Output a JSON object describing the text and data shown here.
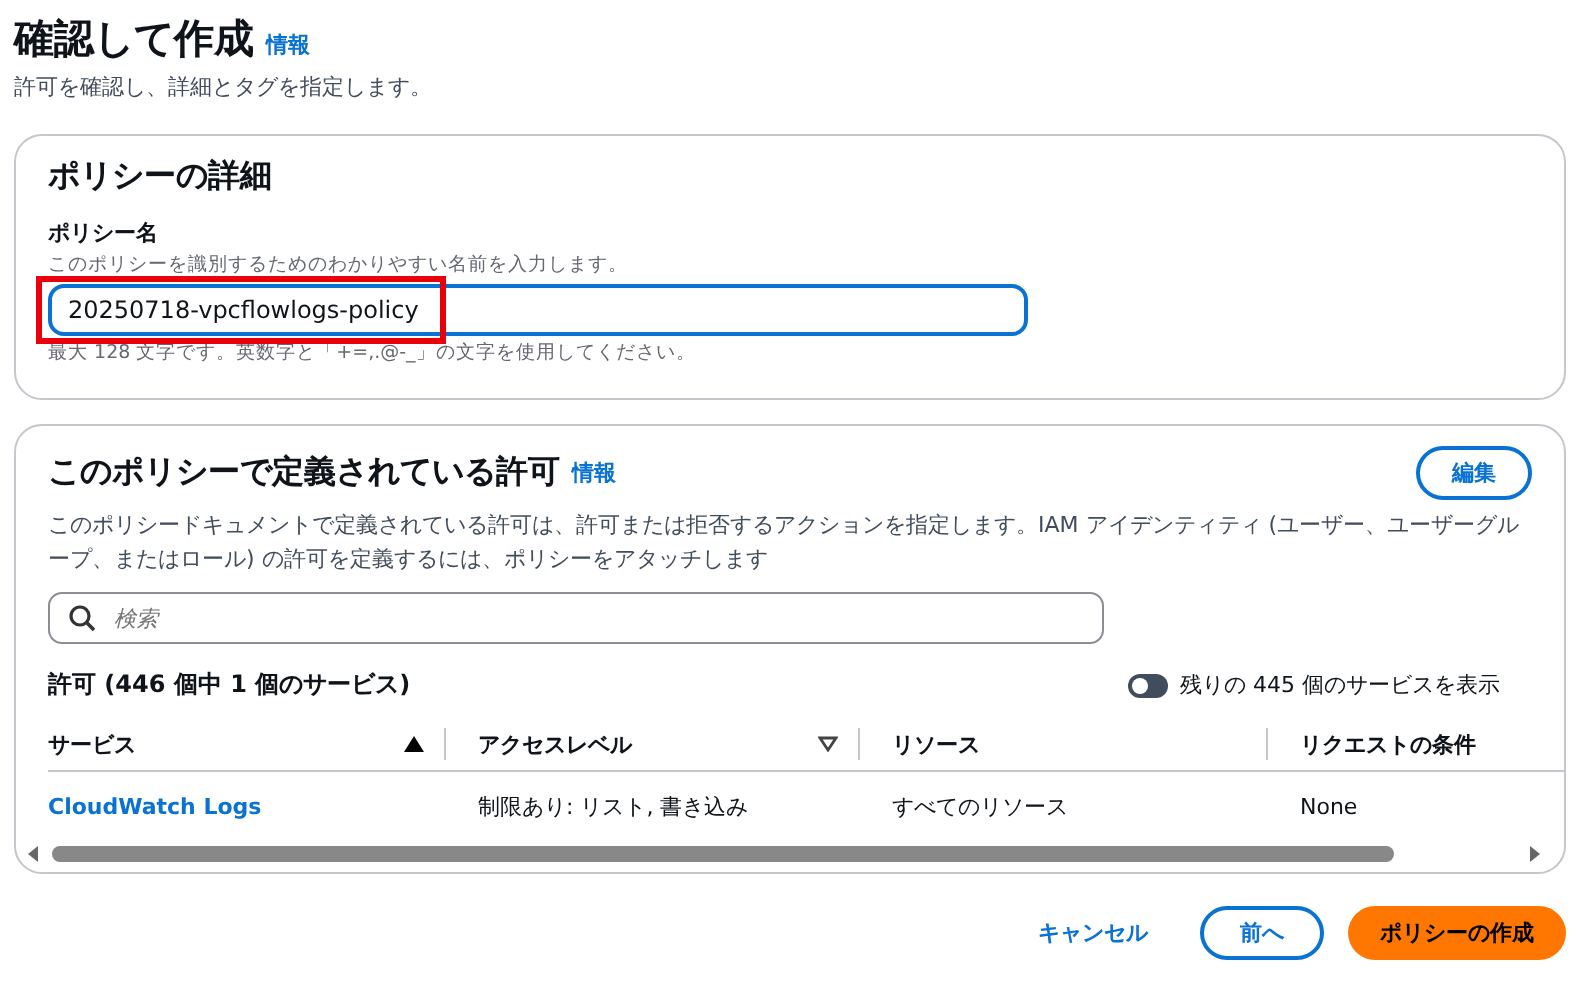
{
  "header": {
    "title": "確認して作成",
    "info_link": "情報",
    "description": "許可を確認し、詳細とタグを指定します。"
  },
  "policy_details": {
    "title": "ポリシーの詳細",
    "name_field": {
      "label": "ポリシー名",
      "hint": "このポリシーを識別するためのわかりやすい名前を入力します。",
      "value": "20250718-vpcflowlogs-policy",
      "highlighted": true,
      "constraint": "最大 128 文字です。英数字と「+=,.@-_」の文字を使用してください。"
    }
  },
  "permissions": {
    "title": "このポリシーで定義されている許可",
    "info_link": "情報",
    "edit_button": "編集",
    "description": "このポリシードキュメントで定義されている許可は、許可または拒否するアクションを指定します。IAM アイデンティティ (ユーザー、ユーザーグループ、またはロール) の許可を定義するには、ポリシーをアタッチします",
    "search": {
      "placeholder": "検索"
    },
    "count_label": "許可 (446 個中 1 個のサービス)",
    "toggle": {
      "label": "残りの 445 個のサービスを表示",
      "on": false
    },
    "table": {
      "columns": [
        {
          "label": "サービス",
          "sorted": true
        },
        {
          "label": "アクセスレベル",
          "sorted": false
        },
        {
          "label": "リソース"
        },
        {
          "label": "リクエストの条件"
        }
      ],
      "rows": [
        {
          "service": "CloudWatch Logs",
          "access_level": "制限あり: リスト, 書き込み",
          "resource": "すべてのリソース",
          "condition": "None"
        }
      ]
    }
  },
  "footer": {
    "cancel": "キャンセル",
    "previous": "前へ",
    "create": "ポリシーの作成"
  }
}
